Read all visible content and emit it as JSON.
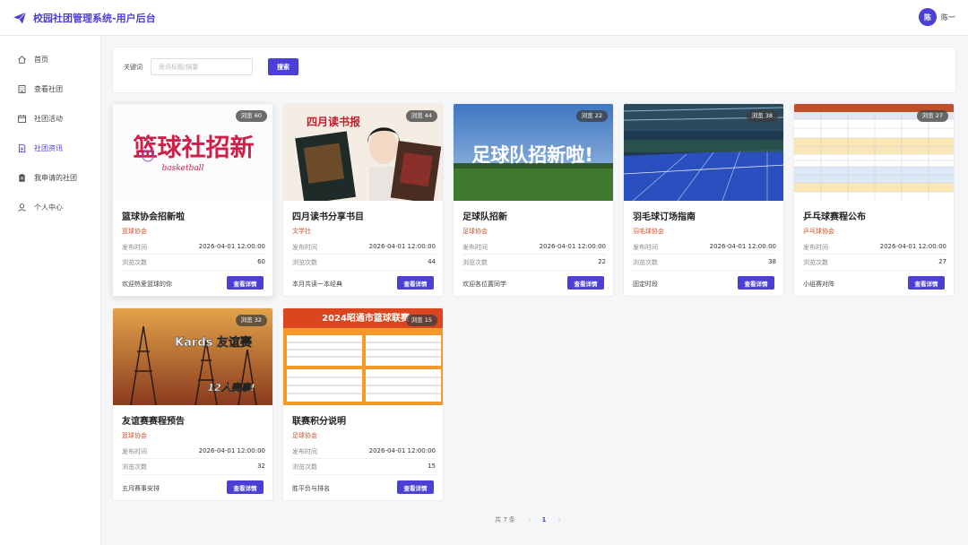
{
  "app": {
    "title": "校园社团管理系统-用户后台"
  },
  "user": {
    "avatar_initial": "陈",
    "name": "陈一"
  },
  "sidebar": {
    "items": [
      {
        "label": "首页",
        "icon": "home-icon",
        "active": false
      },
      {
        "label": "查看社团",
        "icon": "building-icon",
        "active": false
      },
      {
        "label": "社团活动",
        "icon": "calendar-icon",
        "active": false
      },
      {
        "label": "社团资讯",
        "icon": "document-icon",
        "active": true
      },
      {
        "label": "我申请的社团",
        "icon": "clipboard-icon",
        "active": false
      },
      {
        "label": "个人中心",
        "icon": "user-icon",
        "active": false
      }
    ]
  },
  "search": {
    "label": "关键词",
    "placeholder": "资讯标题/摘要",
    "value": "",
    "button": "搜索"
  },
  "labels": {
    "publish_time": "发布时间",
    "view_count": "浏览次数",
    "detail_button": "查看详情",
    "views_prefix": "浏览"
  },
  "cards": [
    {
      "title": "篮球协会招新啦",
      "club": "篮球协会",
      "publish_time": "2026-04-01 12:00:00",
      "views": "60",
      "views_pill": "浏览 60",
      "desc": "欢迎热爱篮球的你",
      "thumb_text": "篮球社招新",
      "thumb_sub": "basketball"
    },
    {
      "title": "四月读书分享书目",
      "club": "文学社",
      "publish_time": "2026-04-01 12:00:00",
      "views": "44",
      "views_pill": "浏览 44",
      "desc": "本月共读一本经典",
      "thumb_text": "四月读书报"
    },
    {
      "title": "足球队招新",
      "club": "足球协会",
      "publish_time": "2026-04-01 12:00:00",
      "views": "22",
      "views_pill": "浏览 22",
      "desc": "欢迎各位置同学",
      "thumb_text": "足球队招新啦!"
    },
    {
      "title": "羽毛球订场指南",
      "club": "羽毛球协会",
      "publish_time": "2026-04-01 12:00:00",
      "views": "38",
      "views_pill": "浏览 38",
      "desc": "固定时段"
    },
    {
      "title": "乒乓球赛程公布",
      "club": "乒乓球协会",
      "publish_time": "2026-04-01 12:00:00",
      "views": "27",
      "views_pill": "浏览 27",
      "desc": "小组赛对阵"
    },
    {
      "title": "友谊赛赛程预告",
      "club": "篮球协会",
      "publish_time": "2026-04-01 12:00:00",
      "views": "32",
      "views_pill": "浏览 32",
      "desc": "五月赛事安排",
      "thumb_text": "Kards 友谊赛",
      "thumb_sub": "12人赛事!"
    },
    {
      "title": "联赛积分说明",
      "club": "足球协会",
      "publish_time": "2026-04-01 12:00:00",
      "views": "15",
      "views_pill": "浏览 15",
      "desc": "胜平负与排名",
      "thumb_text": "2024昭通市篮球联赛"
    }
  ],
  "pagination": {
    "total_text": "共 7 条",
    "current_page": "1"
  },
  "colors": {
    "accent": "#4b3fd6",
    "club": "#d0532d"
  }
}
